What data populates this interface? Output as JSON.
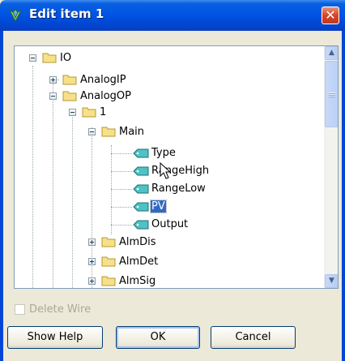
{
  "window": {
    "title": "Edit item 1"
  },
  "tree": {
    "nodes": [
      {
        "label": "IO"
      },
      {
        "label": "AnalogIP"
      },
      {
        "label": "AnalogOP"
      },
      {
        "label": "1"
      },
      {
        "label": "Main"
      },
      {
        "label": "Type"
      },
      {
        "label": "RangeHigh"
      },
      {
        "label": "RangeLow"
      },
      {
        "label": "PV",
        "selected": true
      },
      {
        "label": "Output"
      },
      {
        "label": "AlmDis"
      },
      {
        "label": "AlmDet"
      },
      {
        "label": "AlmSig"
      }
    ]
  },
  "options": {
    "delete_wire_label": "Delete Wire",
    "delete_wire_checked": false
  },
  "buttons": {
    "show_help": "Show Help",
    "ok": "OK",
    "cancel": "Cancel"
  },
  "icons": [
    "app-icon",
    "close-icon",
    "folder-icon",
    "tag-icon",
    "expand-icon",
    "collapse-icon",
    "scroll-up-icon",
    "scroll-down-icon",
    "mouse-cursor-icon"
  ],
  "colors": {
    "titlebar": "#0055e5",
    "selection": "#316ac5",
    "tree_border": "#7f9db9"
  }
}
